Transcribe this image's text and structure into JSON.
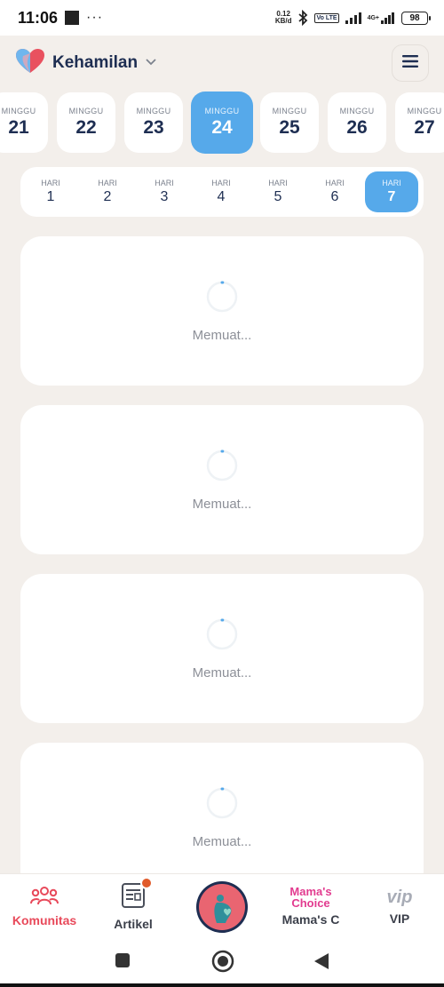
{
  "status_bar": {
    "time": "11:06",
    "dots": "···",
    "net_speed_value": "0.12",
    "net_speed_unit": "KB/d",
    "volte": "Vo LTE",
    "network": "4G+",
    "battery": "98"
  },
  "header": {
    "title": "Kehamilan",
    "logo_icon": "heart-logo-icon",
    "dropdown_icon": "chevron-down-icon",
    "menu_icon": "hamburger-menu-icon"
  },
  "weeks": [
    {
      "label": "MINGGU",
      "number": "21",
      "active": false
    },
    {
      "label": "MINGGU",
      "number": "22",
      "active": false
    },
    {
      "label": "MINGGU",
      "number": "23",
      "active": false
    },
    {
      "label": "MINGGU",
      "number": "24",
      "active": true
    },
    {
      "label": "MINGGU",
      "number": "25",
      "active": false
    },
    {
      "label": "MINGGU",
      "number": "26",
      "active": false
    },
    {
      "label": "MINGGU",
      "number": "27",
      "active": false
    }
  ],
  "days": [
    {
      "label": "HARI",
      "number": "1",
      "active": false
    },
    {
      "label": "HARI",
      "number": "2",
      "active": false
    },
    {
      "label": "HARI",
      "number": "3",
      "active": false
    },
    {
      "label": "HARI",
      "number": "4",
      "active": false
    },
    {
      "label": "HARI",
      "number": "5",
      "active": false
    },
    {
      "label": "HARI",
      "number": "6",
      "active": false
    },
    {
      "label": "HARI",
      "number": "7",
      "active": true
    }
  ],
  "loading_cards": [
    {
      "text": "Memuat..."
    },
    {
      "text": "Memuat..."
    },
    {
      "text": "Memuat..."
    },
    {
      "text": "Memuat..."
    }
  ],
  "bottom_nav": {
    "items": [
      {
        "label": "Komunitas",
        "icon": "community-icon",
        "active": true
      },
      {
        "label": "Artikel",
        "icon": "article-icon",
        "active": false,
        "badge": true
      },
      {
        "label": "",
        "icon": "pregnancy-center-icon",
        "active": false
      },
      {
        "label": "Mama's C",
        "icon": "mamas-choice-logo",
        "logo_line1": "Mama's",
        "logo_line2": "Choice",
        "active": false
      },
      {
        "label": "VIP",
        "icon": "vip-logo",
        "logo_text": "vip",
        "active": false
      }
    ]
  },
  "colors": {
    "accent": "#56a9ea",
    "active_nav": "#e8495a",
    "background": "#f3efeb",
    "title": "#1e2e52"
  }
}
